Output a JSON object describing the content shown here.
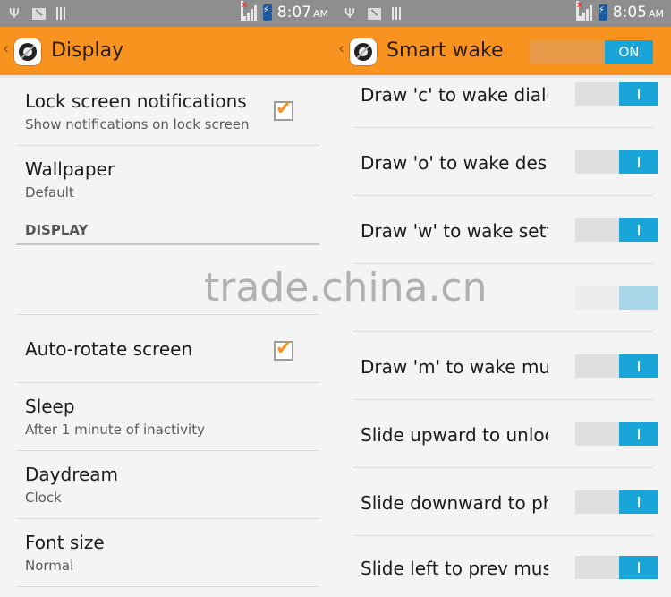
{
  "left": {
    "status": {
      "time": "8:07",
      "ampm": "AM"
    },
    "action_bar": {
      "title": "Display"
    },
    "rows": [
      {
        "title": "Lock screen notifications",
        "subtitle": "Show notifications on lock screen",
        "checked": true
      },
      {
        "title": "Wallpaper",
        "subtitle": "Default"
      }
    ],
    "section": "DISPLAY",
    "rows2": [
      {
        "title": "Auto-rotate screen",
        "checked": true
      },
      {
        "title": "Sleep",
        "subtitle": "After 1 minute of inactivity"
      },
      {
        "title": "Daydream",
        "subtitle": "Clock"
      },
      {
        "title": "Font size",
        "subtitle": "Normal"
      }
    ]
  },
  "right": {
    "status": {
      "time": "8:05",
      "ampm": "AM"
    },
    "action_bar": {
      "title": "Smart wake",
      "master_toggle": "ON"
    },
    "items": [
      {
        "label": "Draw 'c' to wake dialer",
        "on": true
      },
      {
        "label": "Draw 'o' to wake desktop",
        "on": true
      },
      {
        "label": "Draw 'w' to wake settings",
        "on": true
      },
      {
        "label": "",
        "on": true
      },
      {
        "label": "Draw 'm' to wake music",
        "on": true
      },
      {
        "label": "Slide upward to unlock",
        "on": true
      },
      {
        "label": "Slide downward to phone",
        "on": true
      },
      {
        "label": "Slide left to prev music",
        "on": true
      }
    ]
  },
  "watermark": "trade.china.cn",
  "colors": {
    "accent": "#f7931e",
    "switch_on": "#1aa5d8"
  }
}
